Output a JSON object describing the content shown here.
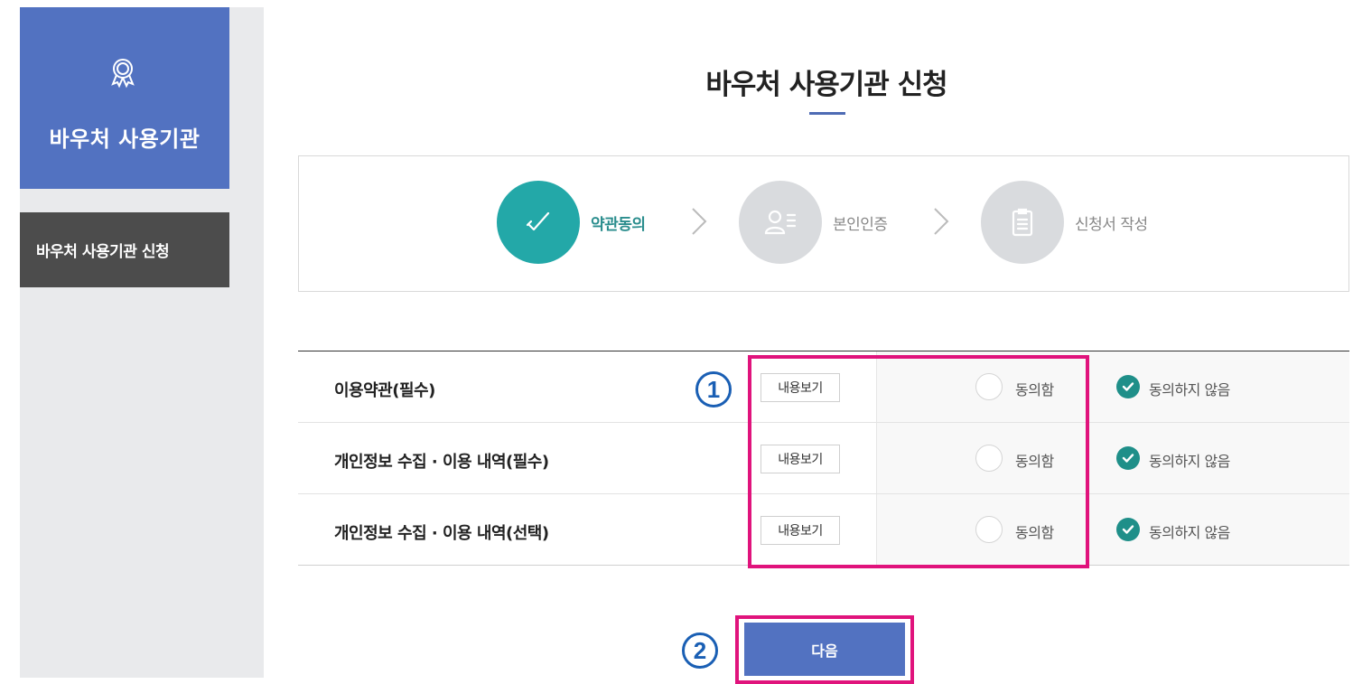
{
  "sidebar": {
    "header_title": "바우처 사용기관",
    "menu_item": "바우처 사용기관 신청"
  },
  "page": {
    "title": "바우처 사용기관 신청"
  },
  "steps": [
    {
      "label": "약관동의",
      "state": "active",
      "icon": "check-icon"
    },
    {
      "label": "본인인증",
      "state": "inactive",
      "icon": "user-list-icon"
    },
    {
      "label": "신청서 작성",
      "state": "inactive",
      "icon": "document-icon"
    }
  ],
  "terms": {
    "view_label": "내용보기",
    "agree_label": "동의함",
    "disagree_label": "동의하지 않음",
    "rows": [
      {
        "title": "이용약관(필수)",
        "selected": "disagree"
      },
      {
        "title": "개인정보 수집 · 이용 내역(필수)",
        "selected": "disagree"
      },
      {
        "title": "개인정보 수집 · 이용 내역(선택)",
        "selected": "disagree"
      }
    ]
  },
  "annotations": {
    "marker_1": "1",
    "marker_2": "2"
  },
  "actions": {
    "next_label": "다음"
  },
  "colors": {
    "brand_blue": "#5272c1",
    "sidebar_dark": "#4c4c4c",
    "step_active": "#23a8a8",
    "check_green": "#1f8f89",
    "highlight_magenta": "#e0137c",
    "marker_blue": "#1a5fb4"
  }
}
